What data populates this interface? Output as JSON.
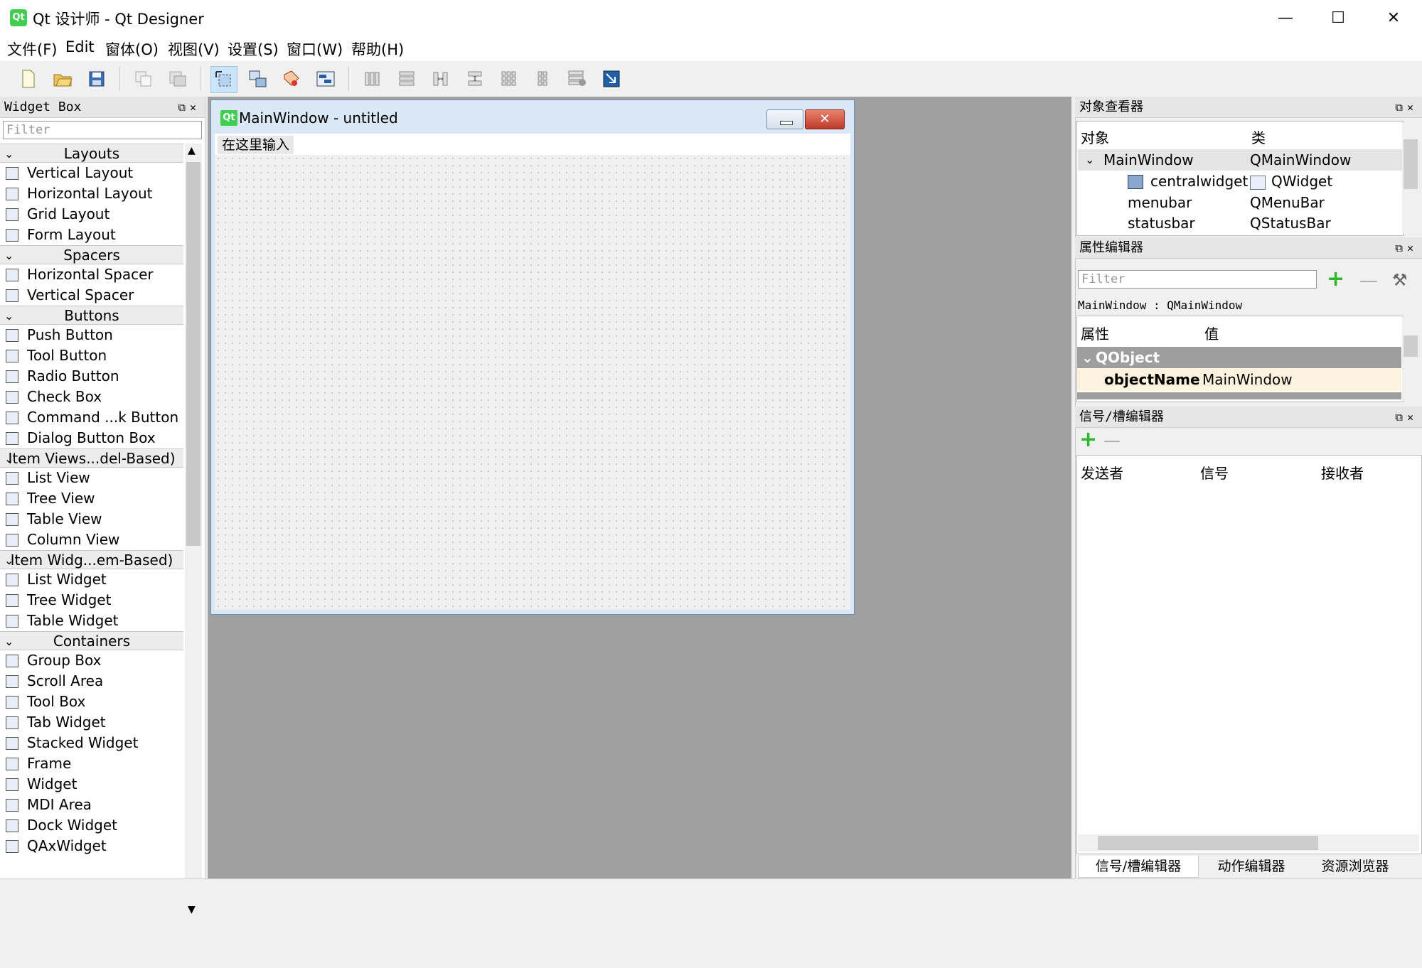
{
  "window": {
    "title": "Qt 设计师 - Qt Designer",
    "app_icon_text": "Qt",
    "minimize": "—",
    "maximize": "☐",
    "close": "✕"
  },
  "menu": {
    "file": "文件(F)",
    "edit": "Edit",
    "form": "窗体(O)",
    "view": "视图(V)",
    "settings": "设置(S)",
    "window": "窗口(W)",
    "help": "帮助(H)"
  },
  "widget_box": {
    "title": "Widget Box",
    "filter_placeholder": "Filter",
    "categories": [
      {
        "label": "Layouts",
        "items": [
          "Vertical Layout",
          "Horizontal Layout",
          "Grid Layout",
          "Form Layout"
        ]
      },
      {
        "label": "Spacers",
        "items": [
          "Horizontal Spacer",
          "Vertical Spacer"
        ]
      },
      {
        "label": "Buttons",
        "items": [
          "Push Button",
          "Tool Button",
          "Radio Button",
          "Check Box",
          "Command ...k Button",
          "Dialog Button Box"
        ]
      },
      {
        "label": "Item Views...del-Based)",
        "items": [
          "List View",
          "Tree View",
          "Table View",
          "Column View"
        ]
      },
      {
        "label": "Item Widg...em-Based)",
        "items": [
          "List Widget",
          "Tree Widget",
          "Table Widget"
        ]
      },
      {
        "label": "Containers",
        "items": [
          "Group Box",
          "Scroll Area",
          "Tool Box",
          "Tab Widget",
          "Stacked Widget",
          "Frame",
          "Widget",
          "MDI Area",
          "Dock Widget",
          "QAxWidget"
        ]
      }
    ]
  },
  "form": {
    "title": "MainWindow - untitled",
    "menu_placeholder": "在这里输入",
    "close_glyph": "✕"
  },
  "object_inspector": {
    "title": "对象查看器",
    "col_object": "对象",
    "col_class": "类",
    "rows": [
      {
        "name": "MainWindow",
        "cls": "QMainWindow"
      },
      {
        "name": "centralwidget",
        "cls": "QWidget"
      },
      {
        "name": "menubar",
        "cls": "QMenuBar"
      },
      {
        "name": "statusbar",
        "cls": "QStatusBar"
      }
    ]
  },
  "property_editor": {
    "title": "属性编辑器",
    "filter_placeholder": "Filter",
    "context": "MainWindow : QMainWindow",
    "col_property": "属性",
    "col_value": "值",
    "group": "QObject",
    "prop_name": "objectName",
    "prop_value": "MainWindow"
  },
  "signal_slot_editor": {
    "title": "信号/槽编辑器",
    "col_sender": "发送者",
    "col_signal": "信号",
    "col_receiver": "接收者"
  },
  "bottom_tabs": [
    "信号/槽编辑器",
    "动作编辑器",
    "资源浏览器"
  ],
  "colors": {
    "qt_green": "#41cd52",
    "selection": "#cce4f7",
    "group_header": "#9e9e9e",
    "prop_row": "#fdf2dd"
  }
}
